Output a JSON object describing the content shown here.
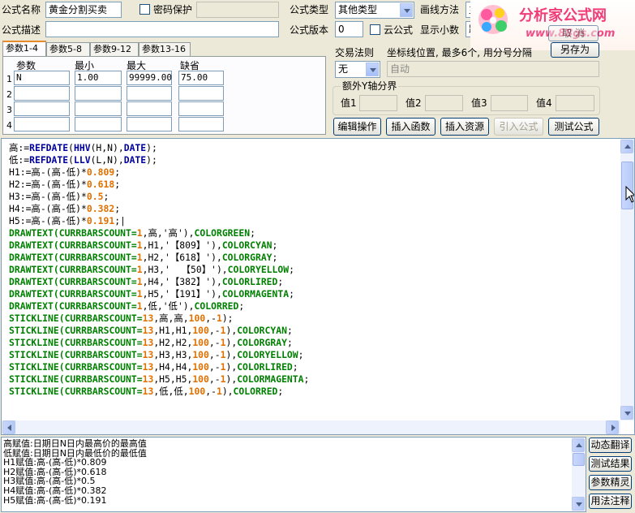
{
  "form": {
    "name_label": "公式名称",
    "name_value": "黄金分割买卖",
    "password_label": "密码保护",
    "desc_label": "公式描述",
    "type_label": "公式类型",
    "type_value": "其他类型",
    "draw_label": "画线方法",
    "draw_value": "主",
    "version_label": "公式版本",
    "version_value": "0",
    "cloud_label": "云公式",
    "decimals_label": "显示小数",
    "decimals_value": "跳",
    "saveas_label": "另存为",
    "cancel_label": "取 消"
  },
  "logo": {
    "title": "分析家公式网",
    "url": "www.88gs.com"
  },
  "tabs": [
    "参数1-4",
    "参数5-8",
    "参数9-12",
    "参数13-16"
  ],
  "params": {
    "headers": [
      "参数",
      "最小",
      "最大",
      "缺省"
    ],
    "rows": [
      {
        "num": "1",
        "name": "N",
        "min": "1.00",
        "max": "99999.00",
        "def": "75.00"
      },
      {
        "num": "2",
        "name": "",
        "min": "",
        "max": "",
        "def": ""
      },
      {
        "num": "3",
        "name": "",
        "min": "",
        "max": "",
        "def": ""
      },
      {
        "num": "4",
        "name": "",
        "min": "",
        "max": "",
        "def": ""
      }
    ]
  },
  "trade": {
    "label": "交易法则",
    "value": "无",
    "coord_label": "坐标线位置, 最多6个, 用分号分隔",
    "coord_value": "自动"
  },
  "yaxis": {
    "title": "额外Y轴分界",
    "labels": [
      "值1",
      "值2",
      "值3",
      "值4"
    ]
  },
  "buttons": [
    "编辑操作",
    "插入函数",
    "插入资源",
    "引入公式",
    "测试公式"
  ],
  "side_buttons": [
    "动态翻译",
    "测试结果",
    "参数精灵",
    "用法注释"
  ],
  "colors": {
    "green": "#008000",
    "orange": "#e07000",
    "blue": "#0000a0",
    "black": "#000000"
  },
  "code_lines": [
    [
      [
        "高:=",
        "black"
      ],
      [
        "REFDATE",
        "blue"
      ],
      [
        "(",
        "black"
      ],
      [
        "HHV",
        "blue"
      ],
      [
        "(H,N),",
        "black"
      ],
      [
        "DATE",
        "blue"
      ],
      [
        ");",
        "black"
      ]
    ],
    [
      [
        "低:=",
        "black"
      ],
      [
        "REFDATE",
        "blue"
      ],
      [
        "(",
        "black"
      ],
      [
        "LLV",
        "blue"
      ],
      [
        "(L,N),",
        "black"
      ],
      [
        "DATE",
        "blue"
      ],
      [
        ");",
        "black"
      ]
    ],
    [
      [
        "H1:=高-(高-低)*",
        "black"
      ],
      [
        "0.809",
        "orange"
      ],
      [
        ";",
        "black"
      ]
    ],
    [
      [
        "H2:=高-(高-低)*",
        "black"
      ],
      [
        "0.618",
        "orange"
      ],
      [
        ";",
        "black"
      ]
    ],
    [
      [
        "H3:=高-(高-低)*",
        "black"
      ],
      [
        "0.5",
        "orange"
      ],
      [
        ";",
        "black"
      ]
    ],
    [
      [
        "H4:=高-(高-低)*",
        "black"
      ],
      [
        "0.382",
        "orange"
      ],
      [
        ";",
        "black"
      ]
    ],
    [
      [
        "H5:=高-(高-低)*",
        "black"
      ],
      [
        "0.191",
        "orange"
      ],
      [
        ";|",
        "black"
      ]
    ],
    [
      [
        "DRAWTEXT(CURRBARSCOUNT=",
        "green"
      ],
      [
        "1",
        "orange"
      ],
      [
        ",高,'高'),",
        "black"
      ],
      [
        "COLORGREEN",
        "green"
      ],
      [
        ";",
        "black"
      ]
    ],
    [
      [
        "DRAWTEXT(CURRBARSCOUNT=",
        "green"
      ],
      [
        "1",
        "orange"
      ],
      [
        ",H1,'【809】'),",
        "black"
      ],
      [
        "COLORCYAN",
        "green"
      ],
      [
        ";",
        "black"
      ]
    ],
    [
      [
        "DRAWTEXT(CURRBARSCOUNT=",
        "green"
      ],
      [
        "1",
        "orange"
      ],
      [
        ",H2,'【618】'),",
        "black"
      ],
      [
        "COLORGRAY",
        "green"
      ],
      [
        ";",
        "black"
      ]
    ],
    [
      [
        "DRAWTEXT(CURRBARSCOUNT=",
        "green"
      ],
      [
        "1",
        "orange"
      ],
      [
        ",H3,'  【50】'),",
        "black"
      ],
      [
        "COLORYELLOW",
        "green"
      ],
      [
        ";",
        "black"
      ]
    ],
    [
      [
        "DRAWTEXT(CURRBARSCOUNT=",
        "green"
      ],
      [
        "1",
        "orange"
      ],
      [
        ",H4,'【382】'),",
        "black"
      ],
      [
        "COLORLIRED",
        "green"
      ],
      [
        ";",
        "black"
      ]
    ],
    [
      [
        "DRAWTEXT(CURRBARSCOUNT=",
        "green"
      ],
      [
        "1",
        "orange"
      ],
      [
        ",H5,'【191】'),",
        "black"
      ],
      [
        "COLORMAGENTA",
        "green"
      ],
      [
        ";",
        "black"
      ]
    ],
    [
      [
        "DRAWTEXT(CURRBARSCOUNT=",
        "green"
      ],
      [
        "1",
        "orange"
      ],
      [
        ",低,'低'),",
        "black"
      ],
      [
        "COLORRED",
        "green"
      ],
      [
        ";",
        "black"
      ]
    ],
    [
      [
        "STICKLINE(CURRBARSCOUNT=",
        "green"
      ],
      [
        "13",
        "orange"
      ],
      [
        ",高,高,",
        "black"
      ],
      [
        "100",
        "orange"
      ],
      [
        ",-",
        "black"
      ],
      [
        "1",
        "orange"
      ],
      [
        ");",
        "black"
      ]
    ],
    [
      [
        "STICKLINE(CURRBARSCOUNT=",
        "green"
      ],
      [
        "13",
        "orange"
      ],
      [
        ",H1,H1,",
        "black"
      ],
      [
        "100",
        "orange"
      ],
      [
        ",-",
        "black"
      ],
      [
        "1",
        "orange"
      ],
      [
        "),",
        "black"
      ],
      [
        "COLORCYAN",
        "green"
      ],
      [
        ";",
        "black"
      ]
    ],
    [
      [
        "STICKLINE(CURRBARSCOUNT=",
        "green"
      ],
      [
        "13",
        "orange"
      ],
      [
        ",H2,H2,",
        "black"
      ],
      [
        "100",
        "orange"
      ],
      [
        ",-",
        "black"
      ],
      [
        "1",
        "orange"
      ],
      [
        "),",
        "black"
      ],
      [
        "COLORGRAY",
        "green"
      ],
      [
        ";",
        "black"
      ]
    ],
    [
      [
        "STICKLINE(CURRBARSCOUNT=",
        "green"
      ],
      [
        "13",
        "orange"
      ],
      [
        ",H3,H3,",
        "black"
      ],
      [
        "100",
        "orange"
      ],
      [
        ",-",
        "black"
      ],
      [
        "1",
        "orange"
      ],
      [
        "),",
        "black"
      ],
      [
        "COLORYELLOW",
        "green"
      ],
      [
        ";",
        "black"
      ]
    ],
    [
      [
        "STICKLINE(CURRBARSCOUNT=",
        "green"
      ],
      [
        "13",
        "orange"
      ],
      [
        ",H4,H4,",
        "black"
      ],
      [
        "100",
        "orange"
      ],
      [
        ",-",
        "black"
      ],
      [
        "1",
        "orange"
      ],
      [
        "),",
        "black"
      ],
      [
        "COLORLIRED",
        "green"
      ],
      [
        ";",
        "black"
      ]
    ],
    [
      [
        "STICKLINE(CURRBARSCOUNT=",
        "green"
      ],
      [
        "13",
        "orange"
      ],
      [
        ",H5,H5,",
        "black"
      ],
      [
        "100",
        "orange"
      ],
      [
        ",-",
        "black"
      ],
      [
        "1",
        "orange"
      ],
      [
        "),",
        "black"
      ],
      [
        "COLORMAGENTA",
        "green"
      ],
      [
        ";",
        "black"
      ]
    ],
    [
      [
        "STICKLINE(CURRBARSCOUNT=",
        "green"
      ],
      [
        "13",
        "orange"
      ],
      [
        ",低,低,",
        "black"
      ],
      [
        "100",
        "orange"
      ],
      [
        ",-",
        "black"
      ],
      [
        "1",
        "orange"
      ],
      [
        "),",
        "black"
      ],
      [
        "COLORRED",
        "green"
      ],
      [
        ";",
        "black"
      ]
    ]
  ],
  "description": [
    "高赋值:日期日N日内最高价的最高值",
    "低赋值:日期日N日内最低价的最低值",
    "H1赋值:高-(高-低)*0.809",
    "H2赋值:高-(高-低)*0.618",
    "H3赋值:高-(高-低)*0.5",
    "H4赋值:高-(高-低)*0.382",
    "H5赋值:高-(高-低)*0.191"
  ]
}
